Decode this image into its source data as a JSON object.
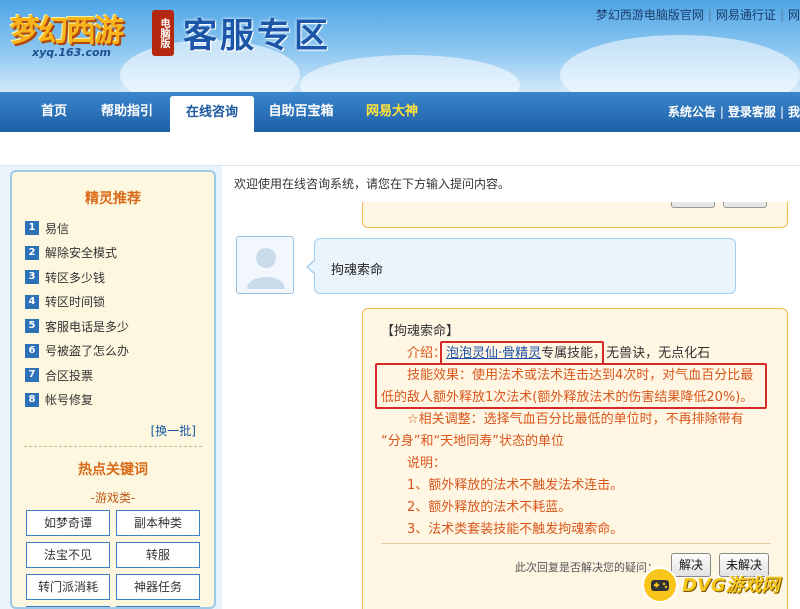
{
  "header": {
    "logo_text": "梦幻西游",
    "logo_url": "xyq.163.com",
    "logo_badge": "电脑版",
    "title": "客服专区",
    "top_links": [
      "梦幻西游电脑版官网",
      "网易通行证",
      "网"
    ]
  },
  "nav": {
    "items": [
      "首页",
      "帮助指引",
      "在线咨询",
      "自助百宝箱",
      "网易大神"
    ],
    "right": [
      "系统公告",
      "登录客服",
      "我"
    ]
  },
  "sidebar": {
    "title": "精灵推荐",
    "items": [
      {
        "num": "1",
        "label": "易信"
      },
      {
        "num": "2",
        "label": "解除安全模式"
      },
      {
        "num": "3",
        "label": "转区多少钱"
      },
      {
        "num": "4",
        "label": "转区时间锁"
      },
      {
        "num": "5",
        "label": "客服电话是多少"
      },
      {
        "num": "6",
        "label": "号被盗了怎么办"
      },
      {
        "num": "7",
        "label": "合区投票"
      },
      {
        "num": "8",
        "label": "帐号修复"
      }
    ],
    "swap": "[换一批]",
    "hot_title": "热点关键词",
    "game_category": "-游戏类-",
    "keywords": [
      "如梦奇谭",
      "副本种类",
      "法宝不见",
      "转服",
      "转门派消耗",
      "神器任务",
      "",
      ""
    ]
  },
  "main": {
    "welcome": "欢迎使用在线咨询系统，请您在下方输入提问内容。",
    "user_message": "拘魂索命",
    "reply": {
      "title": "【拘魂索命】",
      "intro_label": "介绍：",
      "intro_link": "泡泡灵仙·骨精灵",
      "intro_mid": "专属技能",
      "intro_rest": "，无兽诀，无点化石",
      "effect_l1": "技能效果：使用法术或法术连击达到4次时，对气血百分比最",
      "effect_l2": "低的敌人额外释放1次法术(额外释放法术的伤害结果降低20%)。",
      "adjust_l1": "☆相关调整：选择气血百分比最低的单位时，不再排除带有",
      "adjust_l2": "“分身”和“天地同寿”状态的单位",
      "note_label": "说明：",
      "notes": [
        "1、额外释放的法术不触发法术连击。",
        "2、额外释放的法术不耗蓝。",
        "3、法术类套装技能不触发拘魂索命。"
      ],
      "solved_question": "此次回复是否解决您的疑问：",
      "btn_solved": "解决",
      "btn_unsolved": "未解决"
    }
  },
  "watermark": {
    "text": "DVG游戏网"
  },
  "colors": {
    "nav_blue": "#1f5fa6",
    "reply_orange": "#d8561b",
    "highlight_red": "#d62a2a",
    "bubble_border": "#f5b94f"
  }
}
